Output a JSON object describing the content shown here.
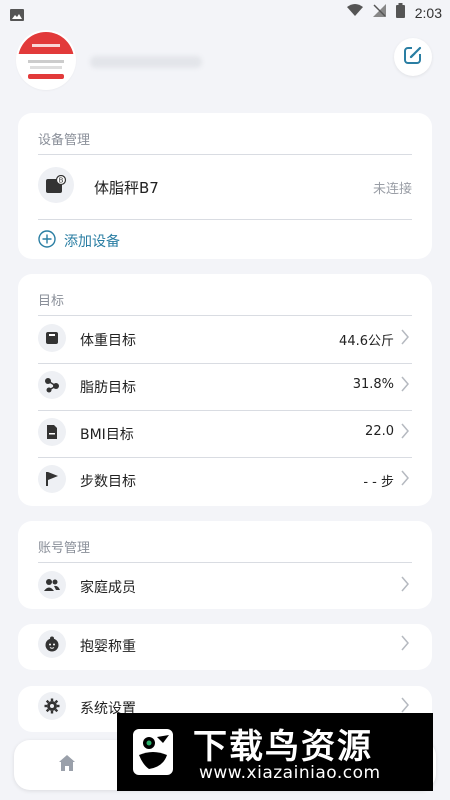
{
  "status_bar": {
    "time": "2:03"
  },
  "profile": {},
  "device_section": {
    "title": "设备管理",
    "device": {
      "name": "体脂秤B7",
      "status": "未连接"
    },
    "add_label": "添加设备"
  },
  "goals_section": {
    "title": "目标",
    "items": [
      {
        "label": "体重目标",
        "value": "44.6公斤",
        "icon": "scale-icon"
      },
      {
        "label": "脂肪目标",
        "value": "31.8%",
        "icon": "molecule-icon"
      },
      {
        "label": "BMI目标",
        "value": "22.0",
        "icon": "document-icon"
      },
      {
        "label": "步数目标",
        "value": "- - 步",
        "icon": "flag-icon"
      }
    ]
  },
  "account_section": {
    "title": "账号管理",
    "items": [
      {
        "label": "家庭成员",
        "icon": "people-icon"
      }
    ]
  },
  "baby_weigh": {
    "label": "抱婴称重",
    "icon": "baby-icon"
  },
  "settings": {
    "label": "系统设置",
    "icon": "gear-icon"
  },
  "watermark": {
    "title": "下载鸟资源",
    "url": "www.xiazainiao.com"
  },
  "colors": {
    "accent": "#2a7ea3",
    "background": "#f3f4f8",
    "card": "#ffffff"
  }
}
